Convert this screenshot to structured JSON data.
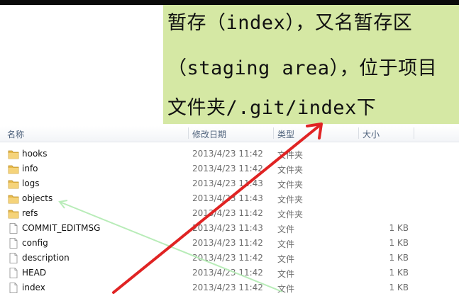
{
  "annotation": {
    "lines": [
      "暂存（index），又名暂存区",
      "（staging area），位于项目",
      "文件夹/.git/index下"
    ]
  },
  "columns": {
    "name": "名称",
    "date": "修改日期",
    "type": "类型",
    "size": "大小"
  },
  "files": [
    {
      "name": "hooks",
      "date": "2013/4/23 11:42",
      "type": "文件夹",
      "size": "",
      "icon": "folder-icon"
    },
    {
      "name": "info",
      "date": "2013/4/23 11:42",
      "type": "文件夹",
      "size": "",
      "icon": "folder-icon"
    },
    {
      "name": "logs",
      "date": "2013/4/23 11:43",
      "type": "文件夹",
      "size": "",
      "icon": "folder-icon"
    },
    {
      "name": "objects",
      "date": "2013/4/23 11:43",
      "type": "文件夹",
      "size": "",
      "icon": "folder-icon"
    },
    {
      "name": "refs",
      "date": "2013/4/23 11:42",
      "type": "文件夹",
      "size": "",
      "icon": "folder-icon"
    },
    {
      "name": "COMMIT_EDITMSG",
      "date": "2013/4/23 11:43",
      "type": "文件",
      "size": "1 KB",
      "icon": "file-icon"
    },
    {
      "name": "config",
      "date": "2013/4/23 11:42",
      "type": "文件",
      "size": "1 KB",
      "icon": "file-icon"
    },
    {
      "name": "description",
      "date": "2013/4/23 11:42",
      "type": "文件",
      "size": "1 KB",
      "icon": "file-icon"
    },
    {
      "name": "HEAD",
      "date": "2013/4/23 11:42",
      "type": "文件",
      "size": "1 KB",
      "icon": "file-icon"
    },
    {
      "name": "index",
      "date": "2013/4/23 11:42",
      "type": "文件",
      "size": "1 KB",
      "icon": "file-icon"
    }
  ],
  "colors": {
    "note_bg": "#d5e8a4",
    "red_arrow": "#e02323",
    "green_arrow": "#b8ecb8"
  }
}
